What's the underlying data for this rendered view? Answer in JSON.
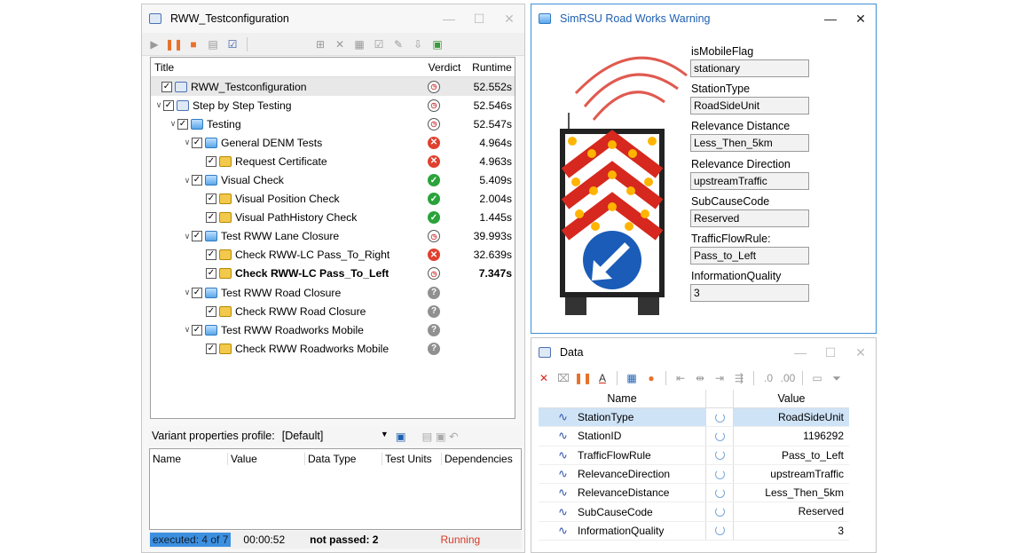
{
  "testwin": {
    "title": "RWW_Testconfiguration",
    "columns": {
      "title": "Title",
      "verdict": "Verdict",
      "runtime": "Runtime"
    },
    "rows": [
      {
        "label": "RWW_Testconfiguration",
        "runtime": "52.552s",
        "verdict": "running",
        "level": 0,
        "icon": "root",
        "expand": ""
      },
      {
        "label": "Step by Step Testing",
        "runtime": "52.546s",
        "verdict": "running",
        "level": 1,
        "icon": "root",
        "expand": "v"
      },
      {
        "label": "Testing",
        "runtime": "52.547s",
        "verdict": "running",
        "level": 2,
        "icon": "folder",
        "expand": "v"
      },
      {
        "label": "General DENM Tests",
        "runtime": "4.964s",
        "verdict": "fail",
        "level": 3,
        "icon": "folder",
        "expand": "v"
      },
      {
        "label": "Request Certificate",
        "runtime": "4.963s",
        "verdict": "fail",
        "level": 4,
        "icon": "test",
        "expand": ""
      },
      {
        "label": "Visual Check",
        "runtime": "5.409s",
        "verdict": "pass",
        "level": 3,
        "icon": "folder",
        "expand": "v"
      },
      {
        "label": "Visual Position Check",
        "runtime": "2.004s",
        "verdict": "pass",
        "level": 4,
        "icon": "test",
        "expand": ""
      },
      {
        "label": "Visual PathHistory Check",
        "runtime": "1.445s",
        "verdict": "pass",
        "level": 4,
        "icon": "test",
        "expand": ""
      },
      {
        "label": "Test RWW Lane Closure",
        "runtime": "39.993s",
        "verdict": "running",
        "level": 3,
        "icon": "folder",
        "expand": "v"
      },
      {
        "label": "Check RWW-LC Pass_To_Right",
        "runtime": "32.639s",
        "verdict": "fail",
        "level": 4,
        "icon": "test",
        "expand": ""
      },
      {
        "label": "Check RWW-LC Pass_To_Left",
        "runtime": "7.347s",
        "verdict": "running",
        "level": 4,
        "icon": "test",
        "expand": "",
        "bold": true
      },
      {
        "label": "Test RWW Road Closure",
        "runtime": "",
        "verdict": "none",
        "level": 3,
        "icon": "folder",
        "expand": "v"
      },
      {
        "label": "Check RWW Road Closure",
        "runtime": "",
        "verdict": "none",
        "level": 4,
        "icon": "test",
        "expand": ""
      },
      {
        "label": "Test RWW Roadworks Mobile",
        "runtime": "",
        "verdict": "none",
        "level": 3,
        "icon": "folder",
        "expand": "v"
      },
      {
        "label": "Check RWW Roadworks Mobile",
        "runtime": "",
        "verdict": "none",
        "level": 4,
        "icon": "test",
        "expand": ""
      }
    ],
    "variant": {
      "label": "Variant properties profile:",
      "value": "[Default]"
    },
    "var_columns": [
      "Name",
      "Value",
      "Data Type",
      "Test Units",
      "Dependencies"
    ],
    "status": {
      "executed": "executed: 4 of 7",
      "time": "00:00:52",
      "notpassed": "not passed: 2",
      "state": "Running"
    }
  },
  "sim": {
    "title": "SimRSU Road Works Warning",
    "fields": [
      {
        "label": "isMobileFlag",
        "value": "stationary"
      },
      {
        "label": "StationType",
        "value": "RoadSideUnit"
      },
      {
        "label": "Relevance Distance",
        "value": "Less_Then_5km"
      },
      {
        "label": "Relevance Direction",
        "value": "upstreamTraffic"
      },
      {
        "label": "SubCauseCode",
        "value": "Reserved"
      },
      {
        "label": "TrafficFlowRule:",
        "value": "Pass_to_Left"
      },
      {
        "label": "InformationQuality",
        "value": "3"
      }
    ]
  },
  "data": {
    "title": "Data",
    "columns": {
      "name": "Name",
      "value": "Value"
    },
    "rows": [
      {
        "name": "StationType",
        "value": "RoadSideUnit"
      },
      {
        "name": "StationID",
        "value": "1196292"
      },
      {
        "name": "TrafficFlowRule",
        "value": "Pass_to_Left"
      },
      {
        "name": "RelevanceDirection",
        "value": "upstreamTraffic"
      },
      {
        "name": "RelevanceDistance",
        "value": "Less_Then_5km"
      },
      {
        "name": "SubCauseCode",
        "value": "Reserved"
      },
      {
        "name": "InformationQuality",
        "value": "3"
      }
    ]
  }
}
